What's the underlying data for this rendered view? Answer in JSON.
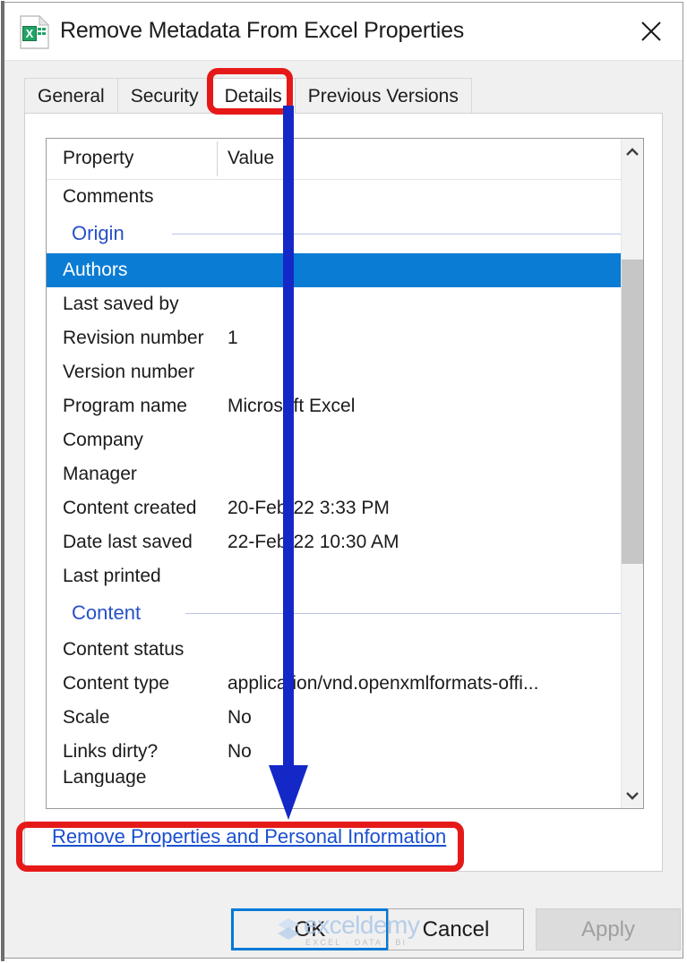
{
  "window": {
    "title": "Remove Metadata From Excel Properties",
    "app_icon": "excel-file-icon",
    "close_icon": "close-icon"
  },
  "tabs": [
    {
      "label": "General",
      "active": false
    },
    {
      "label": "Security",
      "active": false
    },
    {
      "label": "Details",
      "active": true
    },
    {
      "label": "Previous Versions",
      "active": false
    }
  ],
  "list": {
    "columns": {
      "property": "Property",
      "value": "Value"
    },
    "rows": [
      {
        "type": "item",
        "property": "Comments",
        "value": "",
        "selected": false
      },
      {
        "type": "group",
        "property": "Origin",
        "value": ""
      },
      {
        "type": "item",
        "property": "Authors",
        "value": "",
        "selected": true
      },
      {
        "type": "item",
        "property": "Last saved by",
        "value": "",
        "selected": false
      },
      {
        "type": "item",
        "property": "Revision number",
        "value": "1",
        "selected": false
      },
      {
        "type": "item",
        "property": "Version number",
        "value": "",
        "selected": false
      },
      {
        "type": "item",
        "property": "Program name",
        "value": "Microsoft Excel",
        "selected": false
      },
      {
        "type": "item",
        "property": "Company",
        "value": "",
        "selected": false
      },
      {
        "type": "item",
        "property": "Manager",
        "value": "",
        "selected": false
      },
      {
        "type": "item",
        "property": "Content created",
        "value": "20-Feb-22 3:33 PM",
        "selected": false
      },
      {
        "type": "item",
        "property": "Date last saved",
        "value": "22-Feb-22 10:30 AM",
        "selected": false
      },
      {
        "type": "item",
        "property": "Last printed",
        "value": "",
        "selected": false
      },
      {
        "type": "group",
        "property": "Content",
        "value": ""
      },
      {
        "type": "item",
        "property": "Content status",
        "value": "",
        "selected": false
      },
      {
        "type": "item",
        "property": "Content type",
        "value": "application/vnd.openxmlformats-offi...",
        "selected": false
      },
      {
        "type": "item",
        "property": "Scale",
        "value": "No",
        "selected": false
      },
      {
        "type": "item",
        "property": "Links dirty?",
        "value": "No",
        "selected": false
      },
      {
        "type": "clipped",
        "property": "Language",
        "value": "",
        "selected": false
      }
    ],
    "scrollbar": {
      "up_icon": "chevron-up-icon",
      "down_icon": "chevron-down-icon"
    }
  },
  "remove_link": {
    "label": "Remove Properties and Personal Information"
  },
  "buttons": {
    "ok": "OK",
    "cancel": "Cancel",
    "apply": "Apply"
  },
  "watermark": {
    "name": "exceldemy",
    "tagline": "EXCEL · DATA · BI"
  },
  "annotations": {
    "highlight_color": "#e61919",
    "arrow_color": "#1428c8",
    "selection_color": "#0a7cd4",
    "focus_color": "#0078d7",
    "link_color": "#1a4fd0",
    "group_header_color": "#2750c8"
  }
}
